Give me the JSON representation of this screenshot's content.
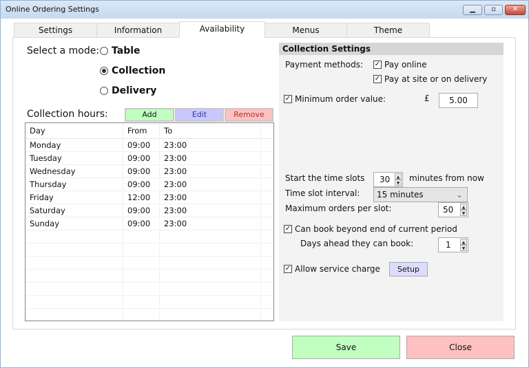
{
  "window": {
    "title": "Online Ordering Settings"
  },
  "tabs": [
    {
      "label": "Settings"
    },
    {
      "label": "Information"
    },
    {
      "label": "Availability",
      "active": true
    },
    {
      "label": "Menus"
    },
    {
      "label": "Theme"
    }
  ],
  "mode": {
    "label": "Select a mode:",
    "options": [
      {
        "label": "Table",
        "selected": false
      },
      {
        "label": "Collection",
        "selected": true
      },
      {
        "label": "Delivery",
        "selected": false
      }
    ]
  },
  "hours": {
    "label": "Collection hours:",
    "add": "Add",
    "edit": "Edit",
    "remove": "Remove",
    "columns": [
      "Day",
      "From",
      "To"
    ],
    "rows": [
      [
        "Monday",
        "09:00",
        "23:00"
      ],
      [
        "Tuesday",
        "09:00",
        "23:00"
      ],
      [
        "Wednesday",
        "09:00",
        "23:00"
      ],
      [
        "Thursday",
        "09:00",
        "23:00"
      ],
      [
        "Friday",
        "12:00",
        "23:00"
      ],
      [
        "Saturday",
        "09:00",
        "23:00"
      ],
      [
        "Sunday",
        "09:00",
        "23:00"
      ]
    ]
  },
  "collection": {
    "title": "Collection Settings",
    "payment_label": "Payment methods:",
    "pay_online": "Pay online",
    "pay_site": "Pay at site or on delivery",
    "min_order_label": "Minimum order value:",
    "currency": "£",
    "min_order_value": "5.00",
    "start_label": "Start the time slots",
    "start_value": "30",
    "start_suffix": "minutes from now",
    "interval_label": "Time slot interval:",
    "interval_value": "15 minutes",
    "max_label": "Maximum orders per slot:",
    "max_value": "50",
    "beyond_label": "Can book beyond end of current period",
    "days_label": "Days ahead they can book:",
    "days_value": "1",
    "service_label": "Allow service charge",
    "setup": "Setup"
  },
  "footer": {
    "save": "Save",
    "close": "Close"
  },
  "colors": {
    "add": "#c0ffc0",
    "edit": "#c8c8ff",
    "remove": "#ffc0c0",
    "save": "#c0ffc0",
    "close": "#ffc0c0"
  }
}
